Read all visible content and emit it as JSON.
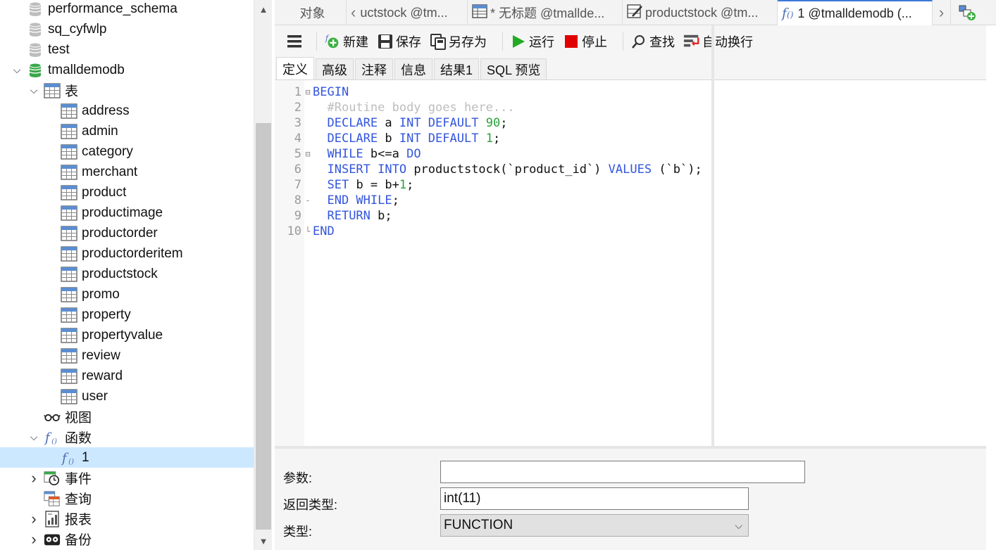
{
  "tree": [
    {
      "label": "performance_schema",
      "icon": "database-icon-gray",
      "indent": 0,
      "chevron": ""
    },
    {
      "label": "sq_cyfwlp",
      "icon": "database-icon-gray",
      "indent": 0,
      "chevron": ""
    },
    {
      "label": "test",
      "icon": "database-icon-gray",
      "indent": 0,
      "chevron": ""
    },
    {
      "label": "tmalldemodb",
      "icon": "database-icon-green",
      "indent": 0,
      "chevron": "down"
    },
    {
      "label": "表",
      "icon": "table-icon",
      "indent": 1,
      "chevron": "down"
    },
    {
      "label": "address",
      "icon": "table-icon",
      "indent": 2,
      "chevron": ""
    },
    {
      "label": "admin",
      "icon": "table-icon",
      "indent": 2,
      "chevron": ""
    },
    {
      "label": "category",
      "icon": "table-icon",
      "indent": 2,
      "chevron": ""
    },
    {
      "label": "merchant",
      "icon": "table-icon",
      "indent": 2,
      "chevron": ""
    },
    {
      "label": "product",
      "icon": "table-icon",
      "indent": 2,
      "chevron": ""
    },
    {
      "label": "productimage",
      "icon": "table-icon",
      "indent": 2,
      "chevron": ""
    },
    {
      "label": "productorder",
      "icon": "table-icon",
      "indent": 2,
      "chevron": ""
    },
    {
      "label": "productorderitem",
      "icon": "table-icon",
      "indent": 2,
      "chevron": ""
    },
    {
      "label": "productstock",
      "icon": "table-icon",
      "indent": 2,
      "chevron": ""
    },
    {
      "label": "promo",
      "icon": "table-icon",
      "indent": 2,
      "chevron": ""
    },
    {
      "label": "property",
      "icon": "table-icon",
      "indent": 2,
      "chevron": ""
    },
    {
      "label": "propertyvalue",
      "icon": "table-icon",
      "indent": 2,
      "chevron": ""
    },
    {
      "label": "review",
      "icon": "table-icon",
      "indent": 2,
      "chevron": ""
    },
    {
      "label": "reward",
      "icon": "table-icon",
      "indent": 2,
      "chevron": ""
    },
    {
      "label": "user",
      "icon": "table-icon",
      "indent": 2,
      "chevron": ""
    },
    {
      "label": "视图",
      "icon": "view-icon",
      "indent": 1,
      "chevron": ""
    },
    {
      "label": "函数",
      "icon": "function-icon",
      "indent": 1,
      "chevron": "down"
    },
    {
      "label": "1",
      "icon": "function-icon",
      "indent": 2,
      "chevron": "",
      "selected": true
    },
    {
      "label": "事件",
      "icon": "event-icon",
      "indent": 1,
      "chevron": "right"
    },
    {
      "label": "查询",
      "icon": "query-icon",
      "indent": 1,
      "chevron": ""
    },
    {
      "label": "报表",
      "icon": "report-icon",
      "indent": 1,
      "chevron": "right"
    },
    {
      "label": "备份",
      "icon": "backup-icon",
      "indent": 1,
      "chevron": "right"
    }
  ],
  "tabs": {
    "objects": "对象",
    "tab1": "uctstock @tm...",
    "tab2": "* 无标题 @tmallde...",
    "tab3": "productstock @tm...",
    "tab4": "1 @tmalldemodb (..."
  },
  "toolbar": {
    "new": "新建",
    "save": "保存",
    "save_as": "另存为",
    "run": "运行",
    "stop": "停止",
    "find": "查找",
    "word_wrap": "自动换行"
  },
  "subtabs": [
    "定义",
    "高级",
    "注释",
    "信息",
    "结果1",
    "SQL 预览"
  ],
  "code_lines": [
    {
      "n": "1",
      "fold": "⊟",
      "indent": "",
      "parts": [
        {
          "t": "BEGIN",
          "c": "kw"
        }
      ]
    },
    {
      "n": "2",
      "fold": "",
      "indent": "  ",
      "parts": [
        {
          "t": "#Routine body goes here...",
          "c": "cmt"
        }
      ]
    },
    {
      "n": "3",
      "fold": "",
      "indent": "  ",
      "parts": [
        {
          "t": "DECLARE",
          "c": "kw"
        },
        {
          "t": " a ",
          "c": ""
        },
        {
          "t": "INT DEFAULT",
          "c": "kw"
        },
        {
          "t": " ",
          "c": ""
        },
        {
          "t": "90",
          "c": "num"
        },
        {
          "t": ";",
          "c": ""
        }
      ]
    },
    {
      "n": "4",
      "fold": "",
      "indent": "  ",
      "parts": [
        {
          "t": "DECLARE",
          "c": "kw"
        },
        {
          "t": " b ",
          "c": ""
        },
        {
          "t": "INT DEFAULT",
          "c": "kw"
        },
        {
          "t": " ",
          "c": ""
        },
        {
          "t": "1",
          "c": "num"
        },
        {
          "t": ";",
          "c": ""
        }
      ]
    },
    {
      "n": "5",
      "fold": "⊟",
      "indent": "  ",
      "parts": [
        {
          "t": "WHILE",
          "c": "kw"
        },
        {
          "t": " b<=a ",
          "c": ""
        },
        {
          "t": "DO",
          "c": "kw"
        }
      ]
    },
    {
      "n": "6",
      "fold": "",
      "indent": "  ",
      "parts": [
        {
          "t": "INSERT INTO",
          "c": "kw"
        },
        {
          "t": " productstock(`product_id`) ",
          "c": ""
        },
        {
          "t": "VALUES",
          "c": "kw"
        },
        {
          "t": " (`b`);",
          "c": ""
        }
      ]
    },
    {
      "n": "7",
      "fold": "",
      "indent": "  ",
      "parts": [
        {
          "t": "SET",
          "c": "kw"
        },
        {
          "t": " b = b+",
          "c": ""
        },
        {
          "t": "1",
          "c": "num"
        },
        {
          "t": ";",
          "c": ""
        }
      ]
    },
    {
      "n": "8",
      "fold": "-",
      "indent": "  ",
      "parts": [
        {
          "t": "END WHILE",
          "c": "kw"
        },
        {
          "t": ";",
          "c": ""
        }
      ]
    },
    {
      "n": "9",
      "fold": "",
      "indent": "  ",
      "parts": [
        {
          "t": "RETURN",
          "c": "kw"
        },
        {
          "t": " b;",
          "c": ""
        }
      ]
    },
    {
      "n": "10",
      "fold": "└",
      "indent": "",
      "parts": [
        {
          "t": "END",
          "c": "kw"
        }
      ]
    }
  ],
  "props": {
    "params_label": "参数:",
    "params_value": "",
    "return_label": "返回类型:",
    "return_value": "int(11)",
    "type_label": "类型:",
    "type_value": "FUNCTION"
  },
  "colors": {
    "selected_row": "#cce8ff",
    "keyword": "#3355dd",
    "number": "#2aa13a",
    "comment": "#bdbdbd",
    "db_green": "#3aa84a",
    "run_green": "#22aa22",
    "stop_red": "#e00000"
  }
}
